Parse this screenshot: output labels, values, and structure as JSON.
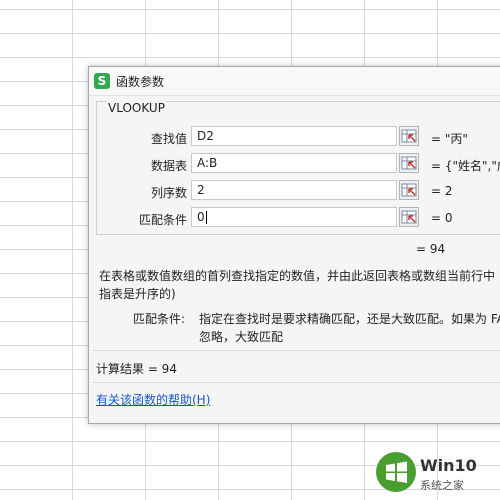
{
  "dialog": {
    "app_icon_letter": "S",
    "title": "函数参数",
    "function_name": "VLOOKUP",
    "args": [
      {
        "label": "查找值",
        "value": "D2",
        "result": "=  \"丙\""
      },
      {
        "label": "数据表",
        "value": "A:B",
        "result": "=  {\"姓名\",\"成"
      },
      {
        "label": "列序数",
        "value": "2",
        "result": "=  2"
      },
      {
        "label": "匹配条件",
        "value": "0",
        "result": "=  0"
      }
    ],
    "total": "=   94",
    "description": "在表格或数值数组的首列查找指定的数值，并由此返回表格或数组当前行中指表是升序的)",
    "param_desc_key": "匹配条件:",
    "param_desc_text": "指定在查找时是要求精确匹配，还是大致匹配。如果为 FA忽略，大致匹配",
    "result_line": "计算结果  =   94",
    "help_link": "有关该函数的帮助(H)"
  },
  "watermark": {
    "title": "Win10",
    "subtitle": "系统之家"
  },
  "colors": {
    "app_icon": "#2fa84f",
    "link": "#1a55c6",
    "watermark_logo": "#4a9e2f"
  }
}
